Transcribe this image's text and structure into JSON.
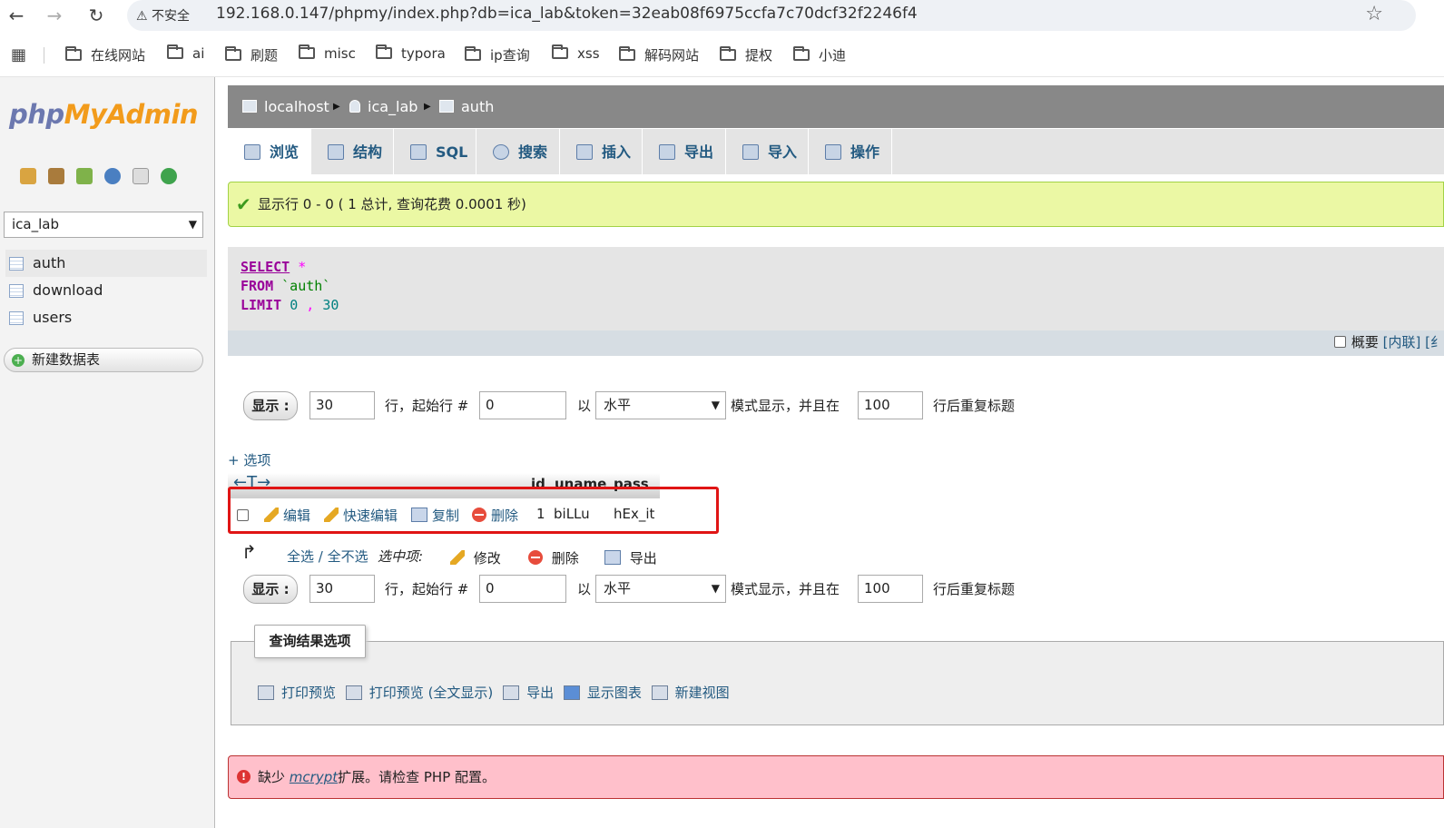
{
  "browser": {
    "insecure_label": "不安全",
    "url": "192.168.0.147/phpmy/index.php?db=ica_lab&token=32eab08f6975ccfa7c70dcf32f2246f4",
    "bookmarks": [
      "在线网站",
      "ai",
      "刷题",
      "misc",
      "typora",
      "ip查询",
      "xss",
      "解码网站",
      "提权",
      "小迪"
    ]
  },
  "sidebar": {
    "logo_php": "php",
    "logo_my": "MyAdmin",
    "db_selected": "ica_lab",
    "tables": [
      "auth",
      "download",
      "users"
    ],
    "new_table": "新建数据表"
  },
  "breadcrumb": {
    "server": "localhost",
    "database": "ica_lab",
    "table": "auth"
  },
  "tabs": [
    "浏览",
    "结构",
    "SQL",
    "搜索",
    "插入",
    "导出",
    "导入",
    "操作"
  ],
  "success_message": "显示行 0 - 0 ( 1 总计, 查询花费 0.0001 秒)",
  "sql": {
    "select": "SELECT",
    "star": "*",
    "from": "FROM",
    "table": "`auth`",
    "limit": "LIMIT",
    "offset": "0",
    "comma": ",",
    "count": "30"
  },
  "sql_footer": {
    "profiling": "概要",
    "inline_open": "[",
    "inline": "内联",
    "inline_close": "] [",
    "edit_partial": "纟"
  },
  "nav": {
    "show_label": "显示 :",
    "rows_value": "30",
    "rows_label": "行，起始行 #",
    "start_value": "0",
    "mode_prefix": "以",
    "mode_value": "水平",
    "mode_suffix": "模式显示，并且在",
    "repeat_value": "100",
    "repeat_suffix": "行后重复标题"
  },
  "options_label": "+ 选项",
  "result": {
    "arrows": "←T→",
    "columns": [
      "id",
      "uname",
      "pass"
    ],
    "row_actions": {
      "edit": "编辑",
      "inline_edit": "快速编辑",
      "copy": "复制",
      "delete": "删除"
    },
    "rows": [
      {
        "id": "1",
        "uname": "biLLu",
        "pass": "hEx_it"
      }
    ]
  },
  "bulk": {
    "check_all": "全选 / 全不选",
    "with_selected": "选中项:",
    "change": "修改",
    "delete": "删除",
    "export": "导出"
  },
  "query_results": {
    "legend": "查询结果选项",
    "print_view": "打印预览",
    "print_full": "打印预览 (全文显示)",
    "export": "导出",
    "chart": "显示图表",
    "create_view": "新建视图"
  },
  "error": {
    "prefix": "缺少",
    "ext": "mcrypt",
    "suffix": "扩展。请检查 PHP 配置。"
  },
  "colors": {
    "link": "#235a81",
    "success_bg": "#ebf8a4",
    "error_bg": "#ffc0cb",
    "highlight": "#e01515"
  }
}
